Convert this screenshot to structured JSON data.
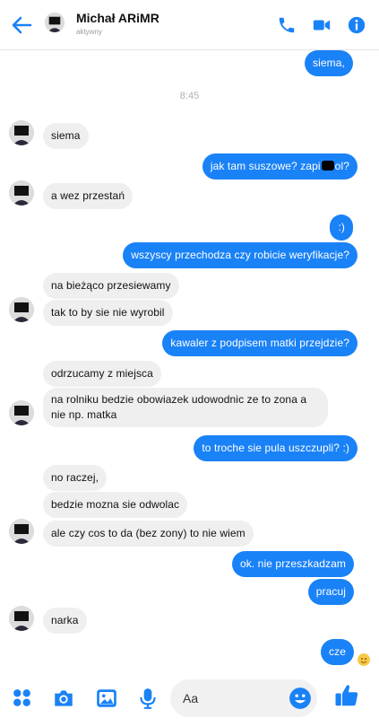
{
  "header": {
    "contact_name": "Michał ARiMR",
    "status": "aktywny",
    "icons": [
      "back-arrow-icon",
      "phone-icon",
      "video-camera-icon",
      "info-icon"
    ]
  },
  "messages": [
    {
      "from": "me",
      "text": "siema,"
    },
    {
      "type": "timestamp",
      "text": "8:45"
    },
    {
      "from": "contact",
      "text": "siema"
    },
    {
      "from": "me",
      "text": "jak tam suszowe? zapi",
      "text_after": "ol?"
    },
    {
      "from": "contact",
      "text": "a wez przestań"
    },
    {
      "from": "me",
      "text": ":)"
    },
    {
      "from": "me",
      "text": "wszyscy przechodza czy robicie weryfikacje?"
    },
    {
      "from": "contact",
      "text": "na bieżąco przesiewamy"
    },
    {
      "from": "contact",
      "text": "tak to by sie nie wyrobil"
    },
    {
      "from": "me",
      "text": "kawaler z podpisem matki przejdzie?"
    },
    {
      "from": "contact",
      "text": "odrzucamy z miejsca"
    },
    {
      "from": "contact",
      "text": "na rolniku bedzie obowiazek udowodnic ze to zona a nie np. matka"
    },
    {
      "from": "me",
      "text": "to troche sie pula uszczupli? :)"
    },
    {
      "from": "contact",
      "text": "no raczej,"
    },
    {
      "from": "contact",
      "text": "bedzie mozna sie odwolac"
    },
    {
      "from": "contact",
      "text": "ale czy cos to da (bez zony) to nie wiem"
    },
    {
      "from": "me",
      "text": "ok. nie przeszkadzam"
    },
    {
      "from": "me",
      "text": "pracuj"
    },
    {
      "from": "contact",
      "text": "narka"
    },
    {
      "from": "me",
      "text": "cze"
    }
  ],
  "composer": {
    "placeholder": "Aa",
    "icons": [
      "apps-grid-icon",
      "camera-icon",
      "gallery-icon",
      "microphone-icon",
      "emoji-icon",
      "thumbs-up-icon"
    ]
  },
  "colors": {
    "accent": "#1a82f7",
    "incoming_bubble": "#efefef"
  }
}
